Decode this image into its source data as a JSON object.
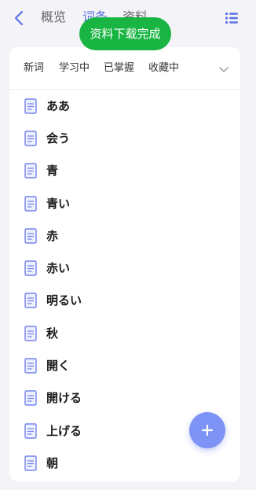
{
  "header": {
    "tabs": [
      {
        "label": "概览"
      },
      {
        "label": "词条"
      },
      {
        "label": "资料"
      }
    ]
  },
  "toast": {
    "text": "资料下载完成"
  },
  "filters": [
    "新词",
    "学习中",
    "已掌握",
    "收藏中"
  ],
  "words": [
    "ああ",
    "会う",
    "青",
    "青い",
    "赤",
    "赤い",
    "明るい",
    "秋",
    "開く",
    "開ける",
    "上げる",
    "朝"
  ],
  "icons": {
    "back": "chevron-left-icon",
    "menu": "list-icon",
    "dropdown": "chevron-down-icon",
    "word": "document-icon",
    "fab": "plus-icon"
  },
  "colors": {
    "accent": "#5b6fe6",
    "toast": "#19b543",
    "fab": "#7d93f5"
  }
}
